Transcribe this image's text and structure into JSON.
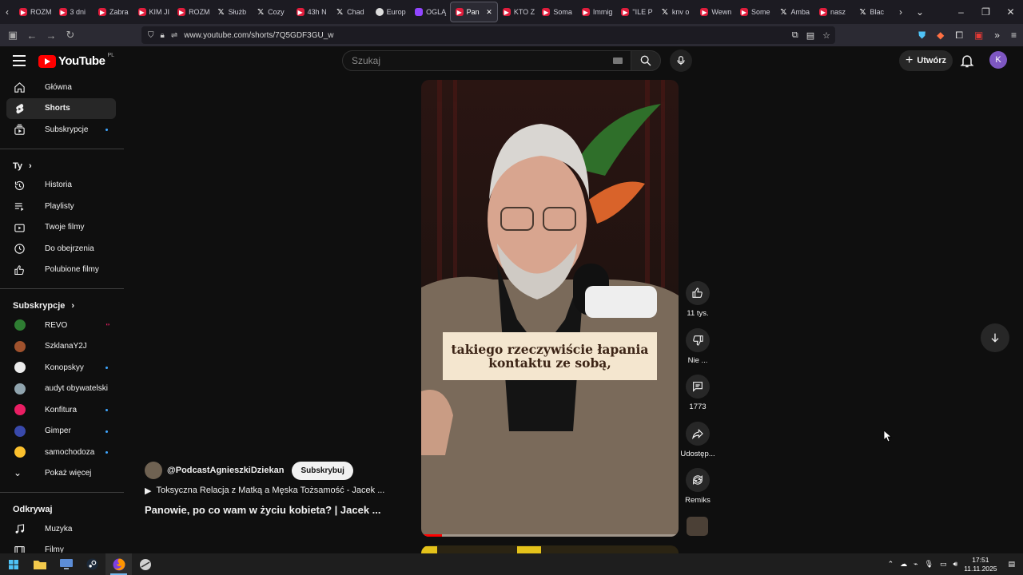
{
  "browser": {
    "tabs": [
      {
        "label": "ROZM",
        "icon": "youtube-icon"
      },
      {
        "label": "3 dni",
        "icon": "youtube-icon"
      },
      {
        "label": "Zabra",
        "icon": "youtube-icon"
      },
      {
        "label": "KIM JI",
        "icon": "youtube-icon"
      },
      {
        "label": "ROZM",
        "icon": "youtube-icon"
      },
      {
        "label": "Służb",
        "icon": "x-icon"
      },
      {
        "label": "Cozy",
        "icon": "x-icon"
      },
      {
        "label": "43h N",
        "icon": "youtube-icon"
      },
      {
        "label": "Chad",
        "icon": "x-icon"
      },
      {
        "label": "Europ",
        "icon": "globe-icon"
      },
      {
        "label": "OGLĄ",
        "icon": "twitch-icon"
      },
      {
        "label": "Pan",
        "icon": "youtube-icon",
        "active": true
      },
      {
        "label": "KTO Z",
        "icon": "youtube-icon"
      },
      {
        "label": "Soma",
        "icon": "youtube-icon"
      },
      {
        "label": "Immig",
        "icon": "youtube-icon"
      },
      {
        "label": "\"ILE P",
        "icon": "youtube-icon"
      },
      {
        "label": "knv o",
        "icon": "x-icon"
      },
      {
        "label": "Wewn",
        "icon": "youtube-icon"
      },
      {
        "label": "Some",
        "icon": "youtube-icon"
      },
      {
        "label": "Amba",
        "icon": "x-icon"
      },
      {
        "label": "nasz",
        "icon": "youtube-icon"
      },
      {
        "label": "Blac",
        "icon": "x-icon"
      }
    ],
    "url": "www.youtube.com/shorts/7Q5GDF3GU_w"
  },
  "header": {
    "logo_text": "YouTube",
    "logo_country": "PL",
    "search_placeholder": "Szukaj",
    "create_label": "Utwórz",
    "avatar_letter": "K"
  },
  "sidebar": {
    "main": [
      {
        "label": "Główna",
        "icon": "home-icon"
      },
      {
        "label": "Shorts",
        "icon": "shorts-icon",
        "active": true
      },
      {
        "label": "Subskrypcje",
        "icon": "subscriptions-icon",
        "dot": true
      }
    ],
    "you_title": "Ty",
    "you": [
      {
        "label": "Historia",
        "icon": "history-icon"
      },
      {
        "label": "Playlisty",
        "icon": "playlist-icon"
      },
      {
        "label": "Twoje filmy",
        "icon": "video-icon"
      },
      {
        "label": "Do obejrzenia",
        "icon": "clock-icon"
      },
      {
        "label": "Polubione filmy",
        "icon": "thumb-up-icon"
      }
    ],
    "subs_title": "Subskrypcje",
    "subs": [
      {
        "label": "REVO",
        "color": "#2e7d32",
        "live": true
      },
      {
        "label": "SzklanaY2J",
        "color": "#a0522d"
      },
      {
        "label": "Konopskyy",
        "color": "#ececec",
        "dot": true
      },
      {
        "label": "audyt obywatelski",
        "color": "#90a4ae"
      },
      {
        "label": "Konfitura",
        "color": "#e91e63",
        "dot": true
      },
      {
        "label": "Gimper",
        "color": "#3949ab",
        "dot": true
      },
      {
        "label": "samochodoza",
        "color": "#fbc02d",
        "dot": true
      }
    ],
    "show_more": "Pokaż więcej",
    "explore_title": "Odkrywaj",
    "explore": [
      {
        "label": "Muzyka",
        "icon": "music-icon"
      },
      {
        "label": "Filmy",
        "icon": "film-icon"
      }
    ]
  },
  "short": {
    "caption": "takiego rzeczywiście łapania kontaktu ze sobą,",
    "progress": 0.08,
    "channel_handle": "@PodcastAgnieszkiDziekan",
    "subscribe_label": "Subskrybuj",
    "related": "Toksyczna Relacja z Matką a Męska Tożsamość - Jacek ...",
    "title": "Panowie, po co wam w życiu kobieta? | Jacek ..."
  },
  "actions": {
    "like": "11 tys.",
    "dislike": "Nie ...",
    "comments": "1773",
    "share": "Udostęp...",
    "remix": "Remiks"
  },
  "taskbar": {
    "time": "17:51",
    "date": "11.11.2025"
  }
}
